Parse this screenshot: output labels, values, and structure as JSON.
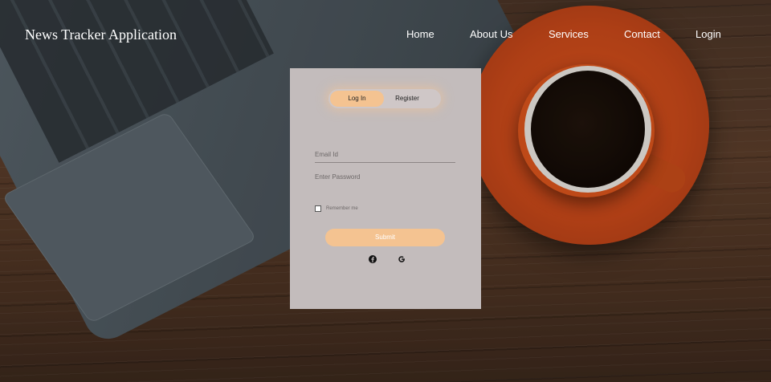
{
  "brand": {
    "title": "News Tracker Application"
  },
  "nav": {
    "items": [
      {
        "label": "Home"
      },
      {
        "label": "About Us"
      },
      {
        "label": "Services"
      },
      {
        "label": "Contact"
      },
      {
        "label": "Login"
      }
    ]
  },
  "auth": {
    "tabs": {
      "login": "Log In",
      "register": "Register",
      "active": "login"
    },
    "email": {
      "placeholder": "Email Id",
      "value": ""
    },
    "password": {
      "placeholder": "Enter Password",
      "value": ""
    },
    "remember": {
      "label": "Remember me",
      "checked": false
    },
    "submit_label": "Submit",
    "social": [
      {
        "icon": "facebook-icon"
      },
      {
        "icon": "google-icon"
      }
    ]
  },
  "colors": {
    "accent": "#f4c391",
    "card_bg": "#c3bcbc",
    "nav_text": "#ffffff"
  }
}
